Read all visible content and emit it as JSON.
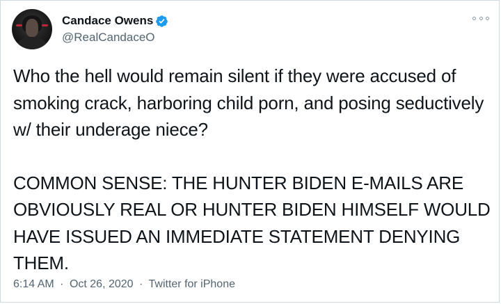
{
  "author": {
    "display_name": "Candace Owens",
    "handle": "@RealCandaceO",
    "verified": true,
    "verified_color": "#1d9bf0"
  },
  "tweet": {
    "paragraph_1": "Who the hell would remain silent if they were accused of smoking crack, harboring child porn, and posing seductively w/ their underage niece?",
    "paragraph_2": "COMMON SENSE: THE HUNTER BIDEN E-MAILS ARE OBVIOUSLY REAL OR HUNTER BIDEN HIMSELF WOULD HAVE ISSUED AN IMMEDIATE STATEMENT DENYING THEM."
  },
  "meta": {
    "time": "6:14 AM",
    "separator": "·",
    "date": "Oct 26, 2020",
    "source": "Twitter for iPhone"
  },
  "icons": {
    "verified": "verified-badge-icon",
    "more": "more-options-icon"
  },
  "colors": {
    "text_primary": "#0f1419",
    "text_secondary": "#536471",
    "border": "#cfd9de"
  }
}
